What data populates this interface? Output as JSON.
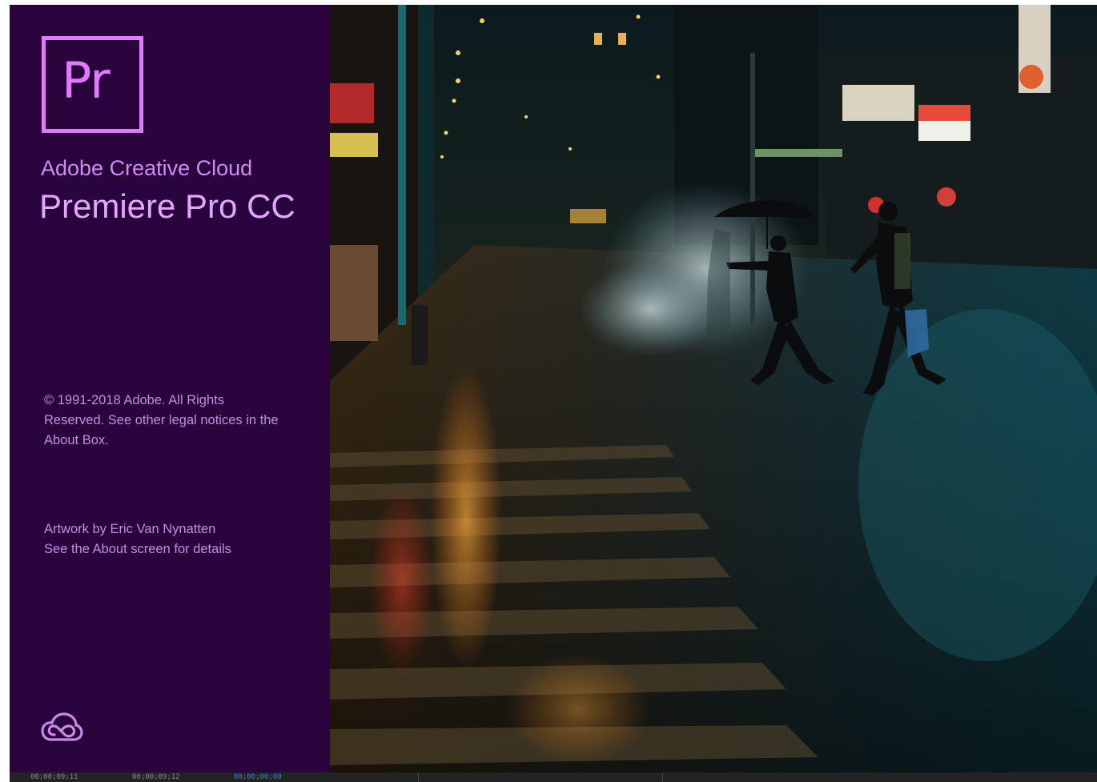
{
  "splash": {
    "app_icon_text": "Pr",
    "suite_name": "Adobe Creative Cloud",
    "product_name": "Premiere Pro CC",
    "copyright": "© 1991-2018 Adobe. All Rights Reserved. See other legal notices in the About Box.",
    "artwork_credit_line1": "Artwork by Eric Van Nynatten",
    "artwork_credit_line2": "See the About screen for details",
    "cc_icon": "creative-cloud-icon",
    "brand_color": "#e07bff",
    "panel_color": "#2a053d"
  },
  "timeline_strip": {
    "timecodes": [
      "00;00;09;11",
      "00;00;09;12",
      "00;00;00;00"
    ]
  }
}
